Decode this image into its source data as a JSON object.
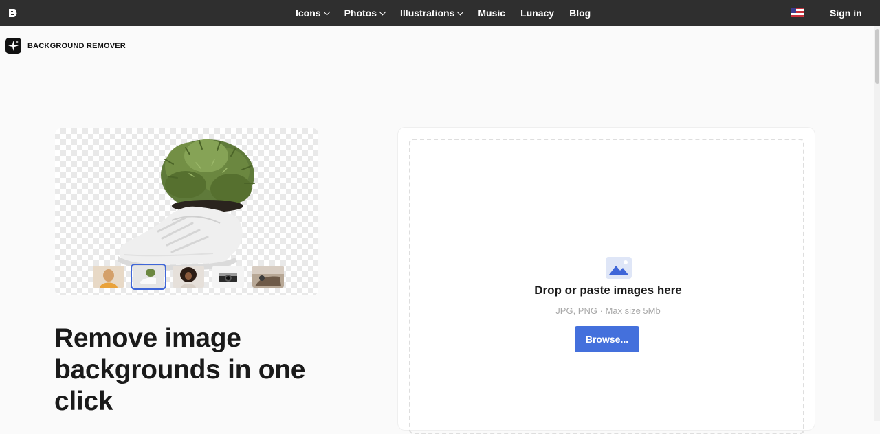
{
  "nav": {
    "items": [
      {
        "label": "Icons",
        "dropdown": true
      },
      {
        "label": "Photos",
        "dropdown": true
      },
      {
        "label": "Illustrations",
        "dropdown": true
      },
      {
        "label": "Music",
        "dropdown": false
      },
      {
        "label": "Lunacy",
        "dropdown": false
      },
      {
        "label": "Blog",
        "dropdown": false
      }
    ],
    "sign_in": "Sign in",
    "language_icon": "us-flag-icon"
  },
  "product": {
    "name": "BACKGROUND REMOVER",
    "icon": "sparkle-icon"
  },
  "preview": {
    "thumbnails": [
      {
        "name": "woman-portrait",
        "active": false
      },
      {
        "name": "sneaker-plant",
        "active": true
      },
      {
        "name": "curly-hair-woman",
        "active": false
      },
      {
        "name": "camera",
        "active": false
      },
      {
        "name": "car-interior",
        "active": false
      }
    ]
  },
  "headline": "Remove image backgrounds in one click",
  "upload": {
    "title": "Drop or paste images here",
    "subtitle": "JPG, PNG · Max size 5Mb",
    "browse_label": "Browse...",
    "icon": "image-upload-icon"
  },
  "colors": {
    "topbar": "#2f2f2f",
    "accent": "#4470dc",
    "background": "#fafafa"
  }
}
